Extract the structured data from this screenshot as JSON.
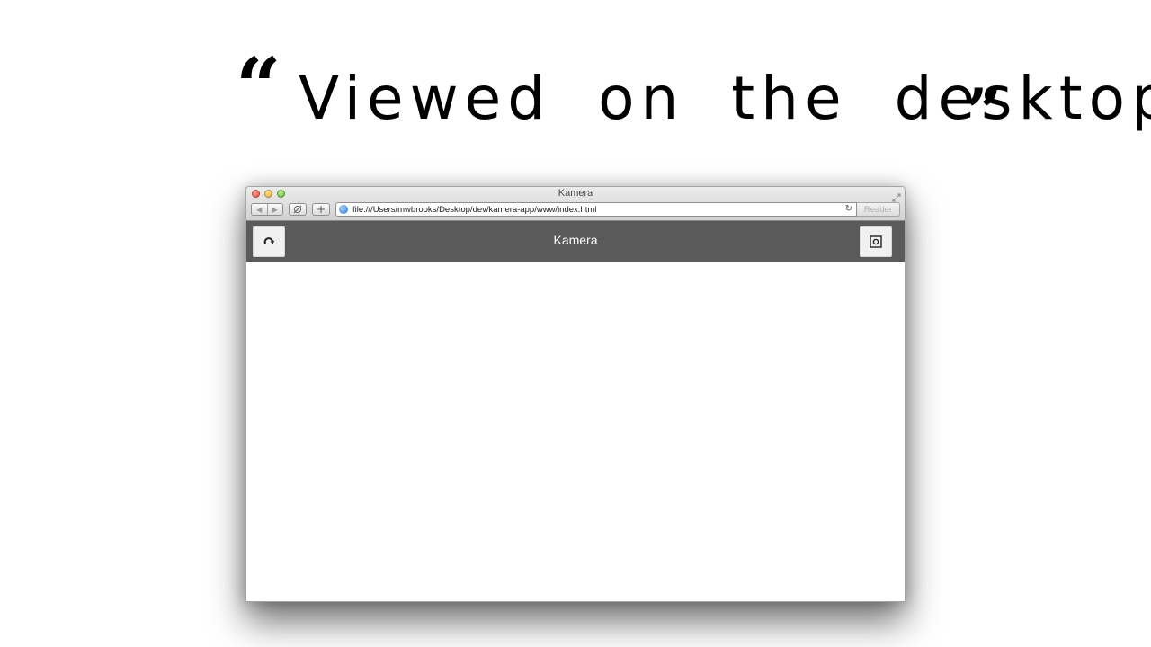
{
  "quote": {
    "open_mark": "“",
    "text": "Viewed on the desktop.",
    "close_mark": "”"
  },
  "browser": {
    "window_title": "Kamera",
    "url": "file:///Users/mwbrooks/Desktop/dev/kamera-app/www/index.html",
    "back_glyph": "◀",
    "forward_glyph": "▶",
    "add_glyph": "+",
    "reload_glyph": "↻",
    "reader_label": "Reader",
    "icons": [
      "close-icon",
      "minimize-icon",
      "zoom-icon",
      "fullscreen-icon",
      "back-icon",
      "forward-icon",
      "share-icon",
      "add-tab-icon",
      "globe-icon",
      "reload-icon"
    ]
  },
  "app": {
    "title": "Kamera",
    "header_color": "#595a59",
    "left_button_icon": "rotate-icon",
    "right_button_icon": "camera-shutter-icon"
  }
}
